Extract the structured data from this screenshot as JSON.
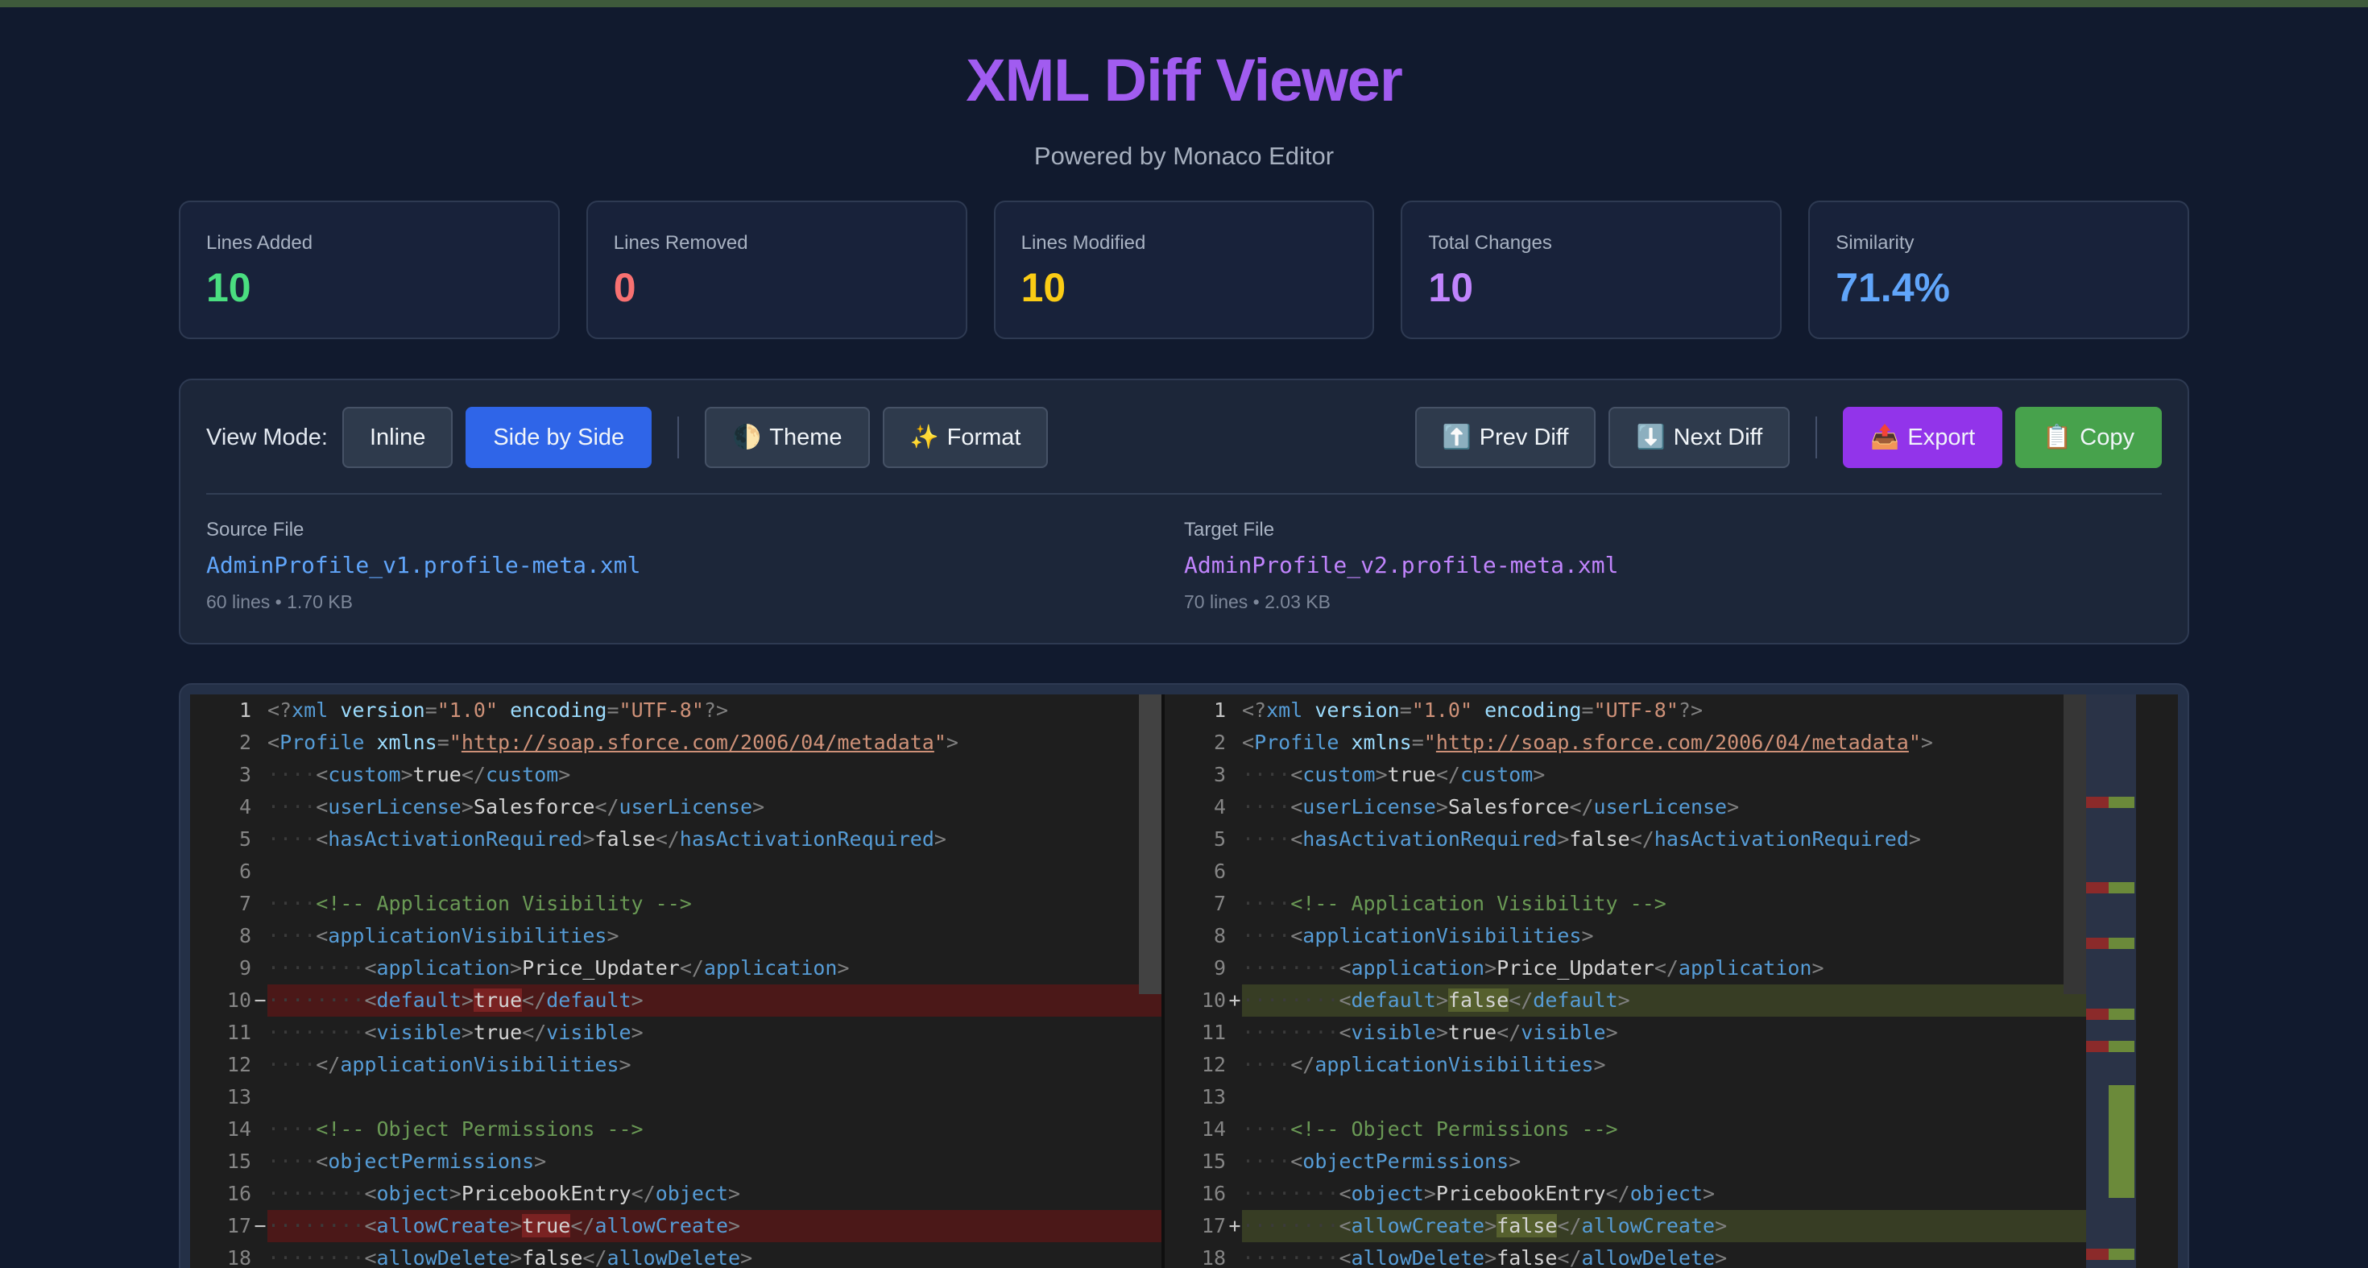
{
  "header": {
    "title": "XML Diff Viewer",
    "subtitle": "Powered by Monaco Editor"
  },
  "stats": [
    {
      "label": "Lines Added",
      "value": "10",
      "color": "#4ade80"
    },
    {
      "label": "Lines Removed",
      "value": "0",
      "color": "#f87171"
    },
    {
      "label": "Lines Modified",
      "value": "10",
      "color": "#facc15"
    },
    {
      "label": "Total Changes",
      "value": "10",
      "color": "#c084fc"
    },
    {
      "label": "Similarity",
      "value": "71.4%",
      "color": "#60a5fa"
    }
  ],
  "toolbar": {
    "view_mode_label": "View Mode:",
    "inline_label": "Inline",
    "side_by_side_label": "Side by Side",
    "theme_icon": "🌓",
    "theme_label": "Theme",
    "format_icon": "✨",
    "format_label": "Format",
    "prev_icon": "⬆️",
    "prev_label": "Prev Diff",
    "next_icon": "⬇️",
    "next_label": "Next Diff",
    "export_icon": "📤",
    "export_label": "Export",
    "copy_icon": "📋",
    "copy_label": "Copy"
  },
  "files": {
    "source": {
      "label": "Source File",
      "name": "AdminProfile_v1.profile-meta.xml",
      "meta": "60 lines • 1.70 KB",
      "color": "#60a5fa"
    },
    "target": {
      "label": "Target File",
      "name": "AdminProfile_v2.profile-meta.xml",
      "meta": "70 lines • 2.03 KB",
      "color": "#c084fc"
    }
  },
  "editor": {
    "left_lines": [
      {
        "n": "1",
        "indent": 0,
        "tokens": [
          [
            "p",
            "<?"
          ],
          [
            "g",
            "xml"
          ],
          [
            "a",
            " version"
          ],
          [
            "p",
            "="
          ],
          [
            "s",
            "\"1.0\""
          ],
          [
            "a",
            " encoding"
          ],
          [
            "p",
            "="
          ],
          [
            "s",
            "\"UTF-8\""
          ],
          [
            "p",
            "?>"
          ]
        ]
      },
      {
        "n": "2",
        "indent": 0,
        "tokens": [
          [
            "p",
            "<"
          ],
          [
            "g",
            "Profile"
          ],
          [
            "a",
            " xmlns"
          ],
          [
            "p",
            "="
          ],
          [
            "s",
            "\""
          ],
          [
            "u",
            "http://soap.sforce.com/2006/04/metadata"
          ],
          [
            "s",
            "\""
          ],
          [
            "p",
            ">"
          ]
        ]
      },
      {
        "n": "3",
        "indent": 1,
        "tokens": [
          [
            "p",
            "<"
          ],
          [
            "g",
            "custom"
          ],
          [
            "p",
            ">"
          ],
          [
            "x",
            "true"
          ],
          [
            "p",
            "</"
          ],
          [
            "g",
            "custom"
          ],
          [
            "p",
            ">"
          ]
        ]
      },
      {
        "n": "4",
        "indent": 1,
        "tokens": [
          [
            "p",
            "<"
          ],
          [
            "g",
            "userLicense"
          ],
          [
            "p",
            ">"
          ],
          [
            "x",
            "Salesforce"
          ],
          [
            "p",
            "</"
          ],
          [
            "g",
            "userLicense"
          ],
          [
            "p",
            ">"
          ]
        ]
      },
      {
        "n": "5",
        "indent": 1,
        "tokens": [
          [
            "p",
            "<"
          ],
          [
            "g",
            "hasActivationRequired"
          ],
          [
            "p",
            ">"
          ],
          [
            "x",
            "false"
          ],
          [
            "p",
            "</"
          ],
          [
            "g",
            "hasActivationRequired"
          ],
          [
            "p",
            ">"
          ]
        ]
      },
      {
        "n": "6",
        "indent": 0,
        "tokens": []
      },
      {
        "n": "7",
        "indent": 1,
        "tokens": [
          [
            "c",
            "<!-- Application Visibility -->"
          ]
        ]
      },
      {
        "n": "8",
        "indent": 1,
        "tokens": [
          [
            "p",
            "<"
          ],
          [
            "g",
            "applicationVisibilities"
          ],
          [
            "p",
            ">"
          ]
        ]
      },
      {
        "n": "9",
        "indent": 2,
        "tokens": [
          [
            "p",
            "<"
          ],
          [
            "g",
            "application"
          ],
          [
            "p",
            ">"
          ],
          [
            "x",
            "Price_Updater"
          ],
          [
            "p",
            "</"
          ],
          [
            "g",
            "application"
          ],
          [
            "p",
            ">"
          ]
        ]
      },
      {
        "n": "10",
        "indent": 2,
        "diff": "removed",
        "mark": "−",
        "tokens": [
          [
            "p",
            "<"
          ],
          [
            "g",
            "default"
          ],
          [
            "p",
            ">"
          ],
          [
            "xr",
            "true"
          ],
          [
            "p",
            "</"
          ],
          [
            "g",
            "default"
          ],
          [
            "p",
            ">"
          ]
        ]
      },
      {
        "n": "11",
        "indent": 2,
        "tokens": [
          [
            "p",
            "<"
          ],
          [
            "g",
            "visible"
          ],
          [
            "p",
            ">"
          ],
          [
            "x",
            "true"
          ],
          [
            "p",
            "</"
          ],
          [
            "g",
            "visible"
          ],
          [
            "p",
            ">"
          ]
        ]
      },
      {
        "n": "12",
        "indent": 1,
        "tokens": [
          [
            "p",
            "</"
          ],
          [
            "g",
            "applicationVisibilities"
          ],
          [
            "p",
            ">"
          ]
        ]
      },
      {
        "n": "13",
        "indent": 0,
        "tokens": []
      },
      {
        "n": "14",
        "indent": 1,
        "tokens": [
          [
            "c",
            "<!-- Object Permissions -->"
          ]
        ]
      },
      {
        "n": "15",
        "indent": 1,
        "tokens": [
          [
            "p",
            "<"
          ],
          [
            "g",
            "objectPermissions"
          ],
          [
            "p",
            ">"
          ]
        ]
      },
      {
        "n": "16",
        "indent": 2,
        "tokens": [
          [
            "p",
            "<"
          ],
          [
            "g",
            "object"
          ],
          [
            "p",
            ">"
          ],
          [
            "x",
            "PricebookEntry"
          ],
          [
            "p",
            "</"
          ],
          [
            "g",
            "object"
          ],
          [
            "p",
            ">"
          ]
        ]
      },
      {
        "n": "17",
        "indent": 2,
        "diff": "removed",
        "mark": "−",
        "tokens": [
          [
            "p",
            "<"
          ],
          [
            "g",
            "allowCreate"
          ],
          [
            "p",
            ">"
          ],
          [
            "xr",
            "true"
          ],
          [
            "p",
            "</"
          ],
          [
            "g",
            "allowCreate"
          ],
          [
            "p",
            ">"
          ]
        ]
      },
      {
        "n": "18",
        "indent": 2,
        "tokens": [
          [
            "p",
            "<"
          ],
          [
            "g",
            "allowDelete"
          ],
          [
            "p",
            ">"
          ],
          [
            "x",
            "false"
          ],
          [
            "p",
            "</"
          ],
          [
            "g",
            "allowDelete"
          ],
          [
            "p",
            ">"
          ]
        ]
      }
    ],
    "right_lines": [
      {
        "n": "1",
        "indent": 0,
        "tokens": [
          [
            "p",
            "<?"
          ],
          [
            "g",
            "xml"
          ],
          [
            "a",
            " version"
          ],
          [
            "p",
            "="
          ],
          [
            "s",
            "\"1.0\""
          ],
          [
            "a",
            " encoding"
          ],
          [
            "p",
            "="
          ],
          [
            "s",
            "\"UTF-8\""
          ],
          [
            "p",
            "?>"
          ]
        ]
      },
      {
        "n": "2",
        "indent": 0,
        "tokens": [
          [
            "p",
            "<"
          ],
          [
            "g",
            "Profile"
          ],
          [
            "a",
            " xmlns"
          ],
          [
            "p",
            "="
          ],
          [
            "s",
            "\""
          ],
          [
            "u",
            "http://soap.sforce.com/2006/04/metadata"
          ],
          [
            "s",
            "\""
          ],
          [
            "p",
            ">"
          ]
        ]
      },
      {
        "n": "3",
        "indent": 1,
        "tokens": [
          [
            "p",
            "<"
          ],
          [
            "g",
            "custom"
          ],
          [
            "p",
            ">"
          ],
          [
            "x",
            "true"
          ],
          [
            "p",
            "</"
          ],
          [
            "g",
            "custom"
          ],
          [
            "p",
            ">"
          ]
        ]
      },
      {
        "n": "4",
        "indent": 1,
        "tokens": [
          [
            "p",
            "<"
          ],
          [
            "g",
            "userLicense"
          ],
          [
            "p",
            ">"
          ],
          [
            "x",
            "Salesforce"
          ],
          [
            "p",
            "</"
          ],
          [
            "g",
            "userLicense"
          ],
          [
            "p",
            ">"
          ]
        ]
      },
      {
        "n": "5",
        "indent": 1,
        "tokens": [
          [
            "p",
            "<"
          ],
          [
            "g",
            "hasActivationRequired"
          ],
          [
            "p",
            ">"
          ],
          [
            "x",
            "false"
          ],
          [
            "p",
            "</"
          ],
          [
            "g",
            "hasActivationRequired"
          ],
          [
            "p",
            ">"
          ]
        ]
      },
      {
        "n": "6",
        "indent": 0,
        "tokens": []
      },
      {
        "n": "7",
        "indent": 1,
        "tokens": [
          [
            "c",
            "<!-- Application Visibility -->"
          ]
        ]
      },
      {
        "n": "8",
        "indent": 1,
        "tokens": [
          [
            "p",
            "<"
          ],
          [
            "g",
            "applicationVisibilities"
          ],
          [
            "p",
            ">"
          ]
        ]
      },
      {
        "n": "9",
        "indent": 2,
        "tokens": [
          [
            "p",
            "<"
          ],
          [
            "g",
            "application"
          ],
          [
            "p",
            ">"
          ],
          [
            "x",
            "Price_Updater"
          ],
          [
            "p",
            "</"
          ],
          [
            "g",
            "application"
          ],
          [
            "p",
            ">"
          ]
        ]
      },
      {
        "n": "10",
        "indent": 2,
        "diff": "added",
        "mark": "+",
        "tokens": [
          [
            "p",
            "<"
          ],
          [
            "g",
            "default"
          ],
          [
            "p",
            ">"
          ],
          [
            "xa",
            "false"
          ],
          [
            "p",
            "</"
          ],
          [
            "g",
            "default"
          ],
          [
            "p",
            ">"
          ]
        ]
      },
      {
        "n": "11",
        "indent": 2,
        "tokens": [
          [
            "p",
            "<"
          ],
          [
            "g",
            "visible"
          ],
          [
            "p",
            ">"
          ],
          [
            "x",
            "true"
          ],
          [
            "p",
            "</"
          ],
          [
            "g",
            "visible"
          ],
          [
            "p",
            ">"
          ]
        ]
      },
      {
        "n": "12",
        "indent": 1,
        "tokens": [
          [
            "p",
            "</"
          ],
          [
            "g",
            "applicationVisibilities"
          ],
          [
            "p",
            ">"
          ]
        ]
      },
      {
        "n": "13",
        "indent": 0,
        "tokens": []
      },
      {
        "n": "14",
        "indent": 1,
        "tokens": [
          [
            "c",
            "<!-- Object Permissions -->"
          ]
        ]
      },
      {
        "n": "15",
        "indent": 1,
        "tokens": [
          [
            "p",
            "<"
          ],
          [
            "g",
            "objectPermissions"
          ],
          [
            "p",
            ">"
          ]
        ]
      },
      {
        "n": "16",
        "indent": 2,
        "tokens": [
          [
            "p",
            "<"
          ],
          [
            "g",
            "object"
          ],
          [
            "p",
            ">"
          ],
          [
            "x",
            "PricebookEntry"
          ],
          [
            "p",
            "</"
          ],
          [
            "g",
            "object"
          ],
          [
            "p",
            ">"
          ]
        ]
      },
      {
        "n": "17",
        "indent": 2,
        "diff": "added",
        "mark": "+",
        "tokens": [
          [
            "p",
            "<"
          ],
          [
            "g",
            "allowCreate"
          ],
          [
            "p",
            ">"
          ],
          [
            "xa",
            "false"
          ],
          [
            "p",
            "</"
          ],
          [
            "g",
            "allowCreate"
          ],
          [
            "p",
            ">"
          ]
        ]
      },
      {
        "n": "18",
        "indent": 2,
        "tokens": [
          [
            "p",
            "<"
          ],
          [
            "g",
            "allowDelete"
          ],
          [
            "p",
            ">"
          ],
          [
            "x",
            "false"
          ],
          [
            "p",
            "</"
          ],
          [
            "g",
            "allowDelete"
          ],
          [
            "p",
            ">"
          ]
        ]
      }
    ]
  }
}
